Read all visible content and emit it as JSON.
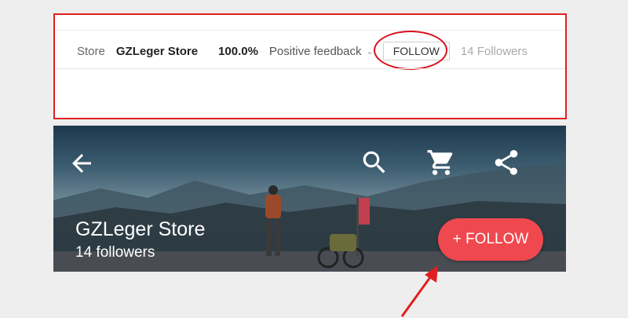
{
  "desktop_bar": {
    "store_label": "Store",
    "store_name": "GZLeger Store",
    "feedback_percent": "100.0%",
    "feedback_label": "Positive feedback",
    "follow_label": "FOLLOW",
    "followers": "14 Followers"
  },
  "mobile_banner": {
    "store_name": "GZLeger Store",
    "followers": "14 followers",
    "follow_label": "+ FOLLOW"
  },
  "icons": {
    "back": "back-arrow-icon",
    "search": "search-icon",
    "cart": "cart-icon",
    "share": "share-icon",
    "dropdown": "chevron-down-icon"
  },
  "colors": {
    "highlight_red": "#e02020",
    "follow_button": "#f0484f"
  }
}
